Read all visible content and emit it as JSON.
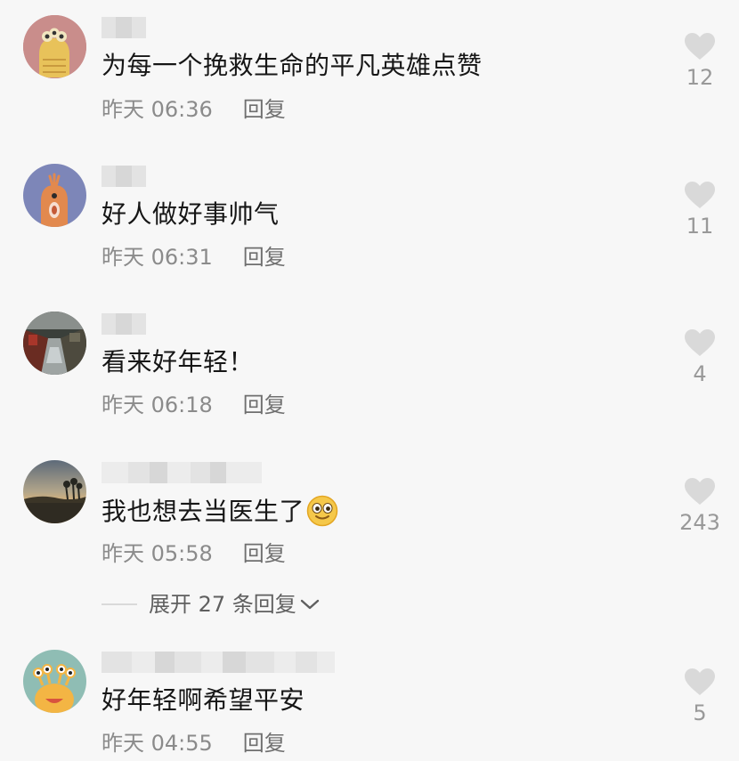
{
  "comments": [
    {
      "text": "为每一个挽救生命的平凡英雄点赞",
      "time": "昨天 06:36",
      "reply": "回复",
      "likes": "12",
      "avatar": "yellow-creature-avatar"
    },
    {
      "text": "好人做好事帅气",
      "time": "昨天 06:31",
      "reply": "回复",
      "likes": "11",
      "avatar": "orange-creature-avatar"
    },
    {
      "text": "看来好年轻！",
      "time": "昨天 06:18",
      "reply": "回复",
      "likes": "4",
      "avatar": "street-photo-avatar"
    },
    {
      "text": "我也想去当医生了",
      "time": "昨天 05:58",
      "reply": "回复",
      "likes": "243",
      "avatar": "sunset-photo-avatar",
      "emoji": "laughing-emoji"
    },
    {
      "text": "好年轻啊希望平安",
      "time": "昨天 04:55",
      "reply": "回复",
      "likes": "5",
      "avatar": "multi-eyed-monster-avatar"
    }
  ],
  "expand_replies": {
    "label": "展开 27 条回复"
  },
  "icons": {
    "like": "heart-icon",
    "expand": "chevron-down-icon"
  },
  "colors": {
    "background": "#f7f7f7",
    "text": "#161616",
    "meta": "#8b8b8b",
    "heart": "#d9d9d9"
  }
}
